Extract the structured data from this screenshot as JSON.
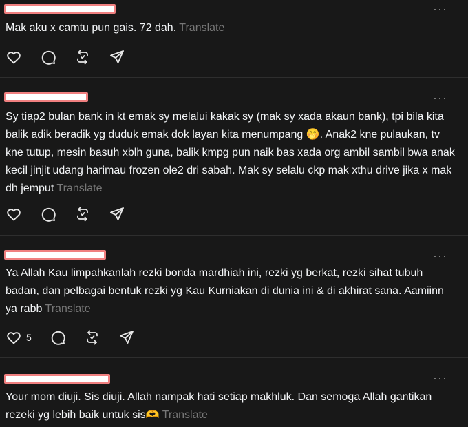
{
  "posts": [
    {
      "text": "Mak aku x camtu pun gais. 72 dah.",
      "translate": "Translate",
      "likes": ""
    },
    {
      "text": "Sy tiap2 bulan bank in kt emak sy melalui kakak sy (mak sy xada akaun bank), tpi bila kita balik adik beradik yg duduk emak dok layan kita menumpang 🤭. Anak2 kne pulaukan, tv kne tutup, mesin basuh xblh guna, balik kmpg pun naik bas xada org ambil sambil bwa anak kecil jinjit udang harimau frozen ole2 dri sabah. Mak sy selalu ckp mak xthu drive jika x mak dh jemput",
      "translate": "Translate",
      "likes": ""
    },
    {
      "text": "Ya Allah Kau limpahkanlah rezki bonda mardhiah ini, rezki yg berkat, rezki sihat tubuh badan, dan pelbagai bentuk rezki yg Kau Kurniakan di dunia ini & di akhirat sana. Aamiinn ya rabb",
      "translate": "Translate",
      "likes": "5"
    },
    {
      "text": "Your mom diuji. Sis diuji. Allah nampak hati setiap makhluk. Dan semoga Allah gantikan rezeki yg lebih baik untuk sis🫶",
      "translate": "Translate",
      "likes": ""
    }
  ],
  "more_label": "···",
  "icons": [
    "heart-icon",
    "reply-icon",
    "repost-icon",
    "share-icon",
    "more-icon"
  ],
  "colors": {
    "background": "#181818",
    "text": "#f3f5f7",
    "muted": "#777777",
    "redaction_border": "#f08080"
  }
}
